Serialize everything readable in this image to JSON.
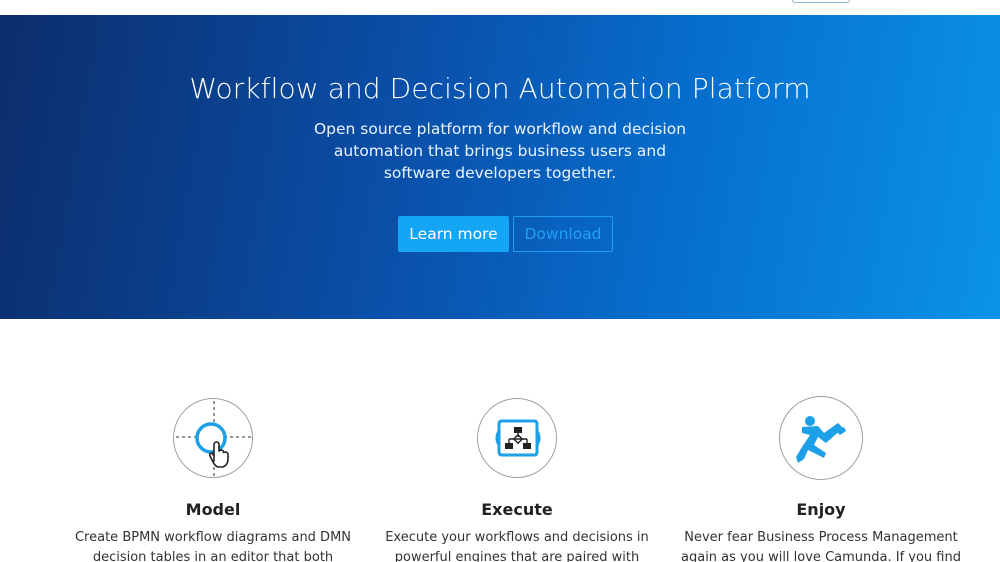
{
  "hero": {
    "title": "Workflow and Decision Automation Platform",
    "subtitle": "Open source platform for workflow and decision automation that brings business users and software developers together.",
    "primary_button": "Learn more",
    "secondary_button": "Download"
  },
  "features": [
    {
      "icon": "model-cursor-icon",
      "title": "Model",
      "text": "Create BPMN workflow diagrams and DMN decision tables in an editor that both business"
    },
    {
      "icon": "execute-flowchart-icon",
      "title": "Execute",
      "text": "Execute your workflows and decisions in powerful engines that are paired with essential"
    },
    {
      "icon": "enjoy-figure-icon",
      "title": "Enjoy",
      "text": "Never fear Business Process Management again as you will love Camunda. If you find that hard"
    }
  ],
  "colors": {
    "accent": "#14a5f5",
    "hero_dark": "#0c2d6b",
    "hero_light": "#0b93e8"
  }
}
